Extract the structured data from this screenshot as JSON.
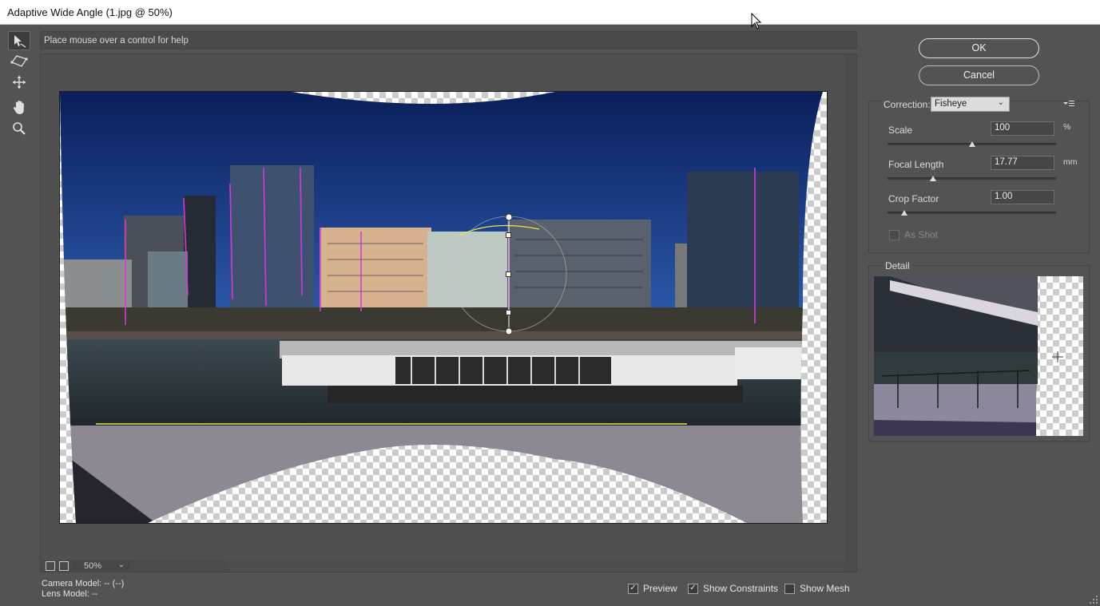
{
  "window": {
    "title": "Adaptive Wide Angle (1.jpg @ 50%)"
  },
  "help": {
    "text": "Place mouse over a control for help"
  },
  "tools": [
    {
      "name": "constraint-tool-icon"
    },
    {
      "name": "polygon-constraint-tool-icon"
    },
    {
      "name": "move-tool-icon"
    },
    {
      "name": "hand-tool-icon"
    },
    {
      "name": "zoom-tool-icon"
    }
  ],
  "zoom": {
    "value": "50%"
  },
  "camera": {
    "camera_model": "Camera Model: -- (--)",
    "lens_model": "Lens Model: --"
  },
  "options": {
    "preview": {
      "label": "Preview",
      "checked": true
    },
    "show_constraints": {
      "label": "Show Constraints",
      "checked": true
    },
    "show_mesh": {
      "label": "Show Mesh",
      "checked": false
    }
  },
  "buttons": {
    "ok": "OK",
    "cancel": "Cancel"
  },
  "correction": {
    "label": "Correction:",
    "value": "Fisheye",
    "scale": {
      "label": "Scale",
      "value": "100",
      "unit": "%",
      "slider_fraction": 0.5
    },
    "focal_length": {
      "label": "Focal Length",
      "value": "17.77",
      "unit": "mm",
      "slider_fraction": 0.27
    },
    "crop_factor": {
      "label": "Crop Factor",
      "value": "1.00",
      "slider_fraction": 0.1
    },
    "as_shot": {
      "label": "As Shot",
      "checked": false,
      "enabled": false
    }
  },
  "detail": {
    "label": "Detail"
  },
  "colors": {
    "dialog_bg": "#535353",
    "sky": "#0f2a6b",
    "constraint_magenta": "#d23ad8",
    "constraint_yellow": "#e8e84a"
  }
}
